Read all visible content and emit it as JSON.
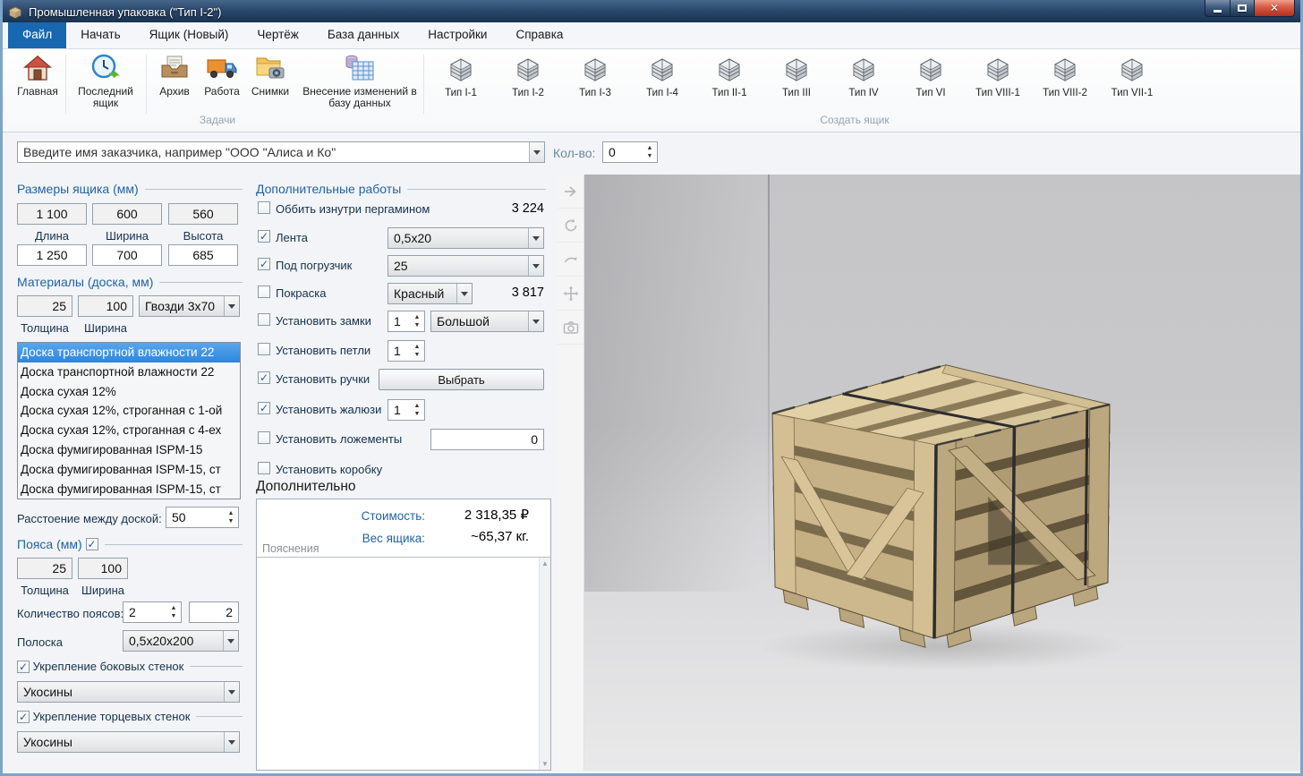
{
  "window": {
    "title": "Промышленная упаковка (\"Тип I-2\")"
  },
  "menu": {
    "tabs": [
      {
        "label": "Файл",
        "active": true
      },
      {
        "label": "Начать",
        "active": false
      },
      {
        "label": "Ящик (Новый)",
        "active": false
      },
      {
        "label": "Чертёж",
        "active": false
      },
      {
        "label": "База данных",
        "active": false
      },
      {
        "label": "Настройки",
        "active": false
      },
      {
        "label": "Справка",
        "active": false
      }
    ]
  },
  "ribbon": {
    "tasks": [
      {
        "label": "Главная",
        "icon": "home-icon"
      },
      {
        "label": "Последний ящик",
        "icon": "recent-clock-icon"
      },
      {
        "label": "Архив",
        "icon": "archive-icon"
      },
      {
        "label": "Работа",
        "icon": "truck-icon"
      },
      {
        "label": "Снимки",
        "icon": "snapshots-folder-camera-icon"
      },
      {
        "label": "Внесение изменений в базу данных",
        "icon": "database-table-icon"
      }
    ],
    "tasks_group_label": "Задачи",
    "box_types": [
      {
        "label": "Тип I-1"
      },
      {
        "label": "Тип I-2"
      },
      {
        "label": "Тип I-3"
      },
      {
        "label": "Тип I-4"
      },
      {
        "label": "Тип II-1"
      },
      {
        "label": "Тип III"
      },
      {
        "label": "Тип IV"
      },
      {
        "label": "Тип VI"
      },
      {
        "label": "Тип VIII-1"
      },
      {
        "label": "Тип VIII-2"
      },
      {
        "label": "Тип VII-1"
      }
    ],
    "box_types_group_label": "Создать ящик"
  },
  "customer": {
    "placeholder": "Введите имя заказчика, например \"ООО \"Алиса и Ко\"",
    "qty_label": "Кол-во:",
    "qty_value": "0"
  },
  "dimensions": {
    "header": "Размеры ящика (мм)",
    "outer": [
      "1 100",
      "600",
      "560"
    ],
    "labels": [
      "Длина",
      "Ширина",
      "Высота"
    ],
    "inner": [
      "1 250",
      "700",
      "685"
    ]
  },
  "materials": {
    "header": "Материалы (доска, мм)",
    "thickness": "25",
    "width": "100",
    "nails": "Гвозди 3х70",
    "thickness_label": "Толщина",
    "width_label": "Ширина",
    "board_options": [
      {
        "label": "Доска транспортной влажности 22",
        "active": true
      },
      {
        "label": "Доска транспортной влажности 22",
        "active": false
      },
      {
        "label": "Доска сухая 12%",
        "active": false
      },
      {
        "label": "Доска сухая 12%, строганная с 1-ой",
        "active": false
      },
      {
        "label": "Доска сухая 12%, строганная с 4-ех",
        "active": false
      },
      {
        "label": "Доска фумигированная ISPM-15",
        "active": false
      },
      {
        "label": "Доска фумигированная ISPM-15, ст",
        "active": false
      },
      {
        "label": "Доска фумигированная ISPM-15, ст",
        "active": false
      }
    ]
  },
  "board_spacing": {
    "label": "Расстоение между доской:",
    "value": "50"
  },
  "belts": {
    "header": "Пояса (мм)",
    "checked": true,
    "thickness": "25",
    "width": "100",
    "thickness_label": "Толщина",
    "width_label": "Ширина",
    "count_label": "Количество поясов:",
    "count": "2",
    "count2": "2",
    "strip_label": "Полоска",
    "strip_value": "0,5х20х200"
  },
  "reinforcement": {
    "side_label": "Укрепление боковых стенок",
    "side_checked": true,
    "side_value": "Укосины",
    "end_label": "Укрепление торцевых стенок",
    "end_checked": true,
    "end_value": "Укосины"
  },
  "works": {
    "header": "Дополнительные работы",
    "pergamin": {
      "label": "Оббить изнутри пергамином",
      "checked": false,
      "price": "3 224"
    },
    "tape": {
      "label": "Лента",
      "checked": true,
      "value": "0,5х20"
    },
    "forklift": {
      "label": "Под погрузчик",
      "checked": true,
      "value": "25"
    },
    "paint": {
      "label": "Покраска",
      "checked": false,
      "value": "Красный",
      "price": "3 817"
    },
    "locks": {
      "label": "Установить замки",
      "checked": false,
      "count": "1",
      "size": "Большой"
    },
    "hinges": {
      "label": "Установить петли",
      "checked": false,
      "count": "1"
    },
    "handles": {
      "label": "Установить ручки",
      "checked": true,
      "button": "Выбрать"
    },
    "louvers": {
      "label": "Установить жалюзи",
      "checked": true,
      "count": "1"
    },
    "lodgements": {
      "label": "Установить ложементы",
      "checked": false,
      "value": "0"
    },
    "box": {
      "label": "Установить коробку",
      "checked": false
    }
  },
  "summary": {
    "header": "Дополнительно",
    "cost_label": "Стоимость:",
    "cost_value": "2 318,35 ₽",
    "weight_label": "Вес ящика:",
    "weight_value": "~65,37 кг.",
    "notes_label": "Пояснения",
    "notes_value": ""
  },
  "viewport": {
    "tools": [
      "forward-arrow",
      "rotate",
      "orbit-back",
      "pan-move",
      "camera"
    ]
  },
  "colors": {
    "accent": "#1767b1",
    "header_text": "#2263a5",
    "label_text": "#17314e",
    "selection": "#3d8fe0",
    "titlebar": "#1c3a58",
    "close_button": "#c0392b"
  }
}
